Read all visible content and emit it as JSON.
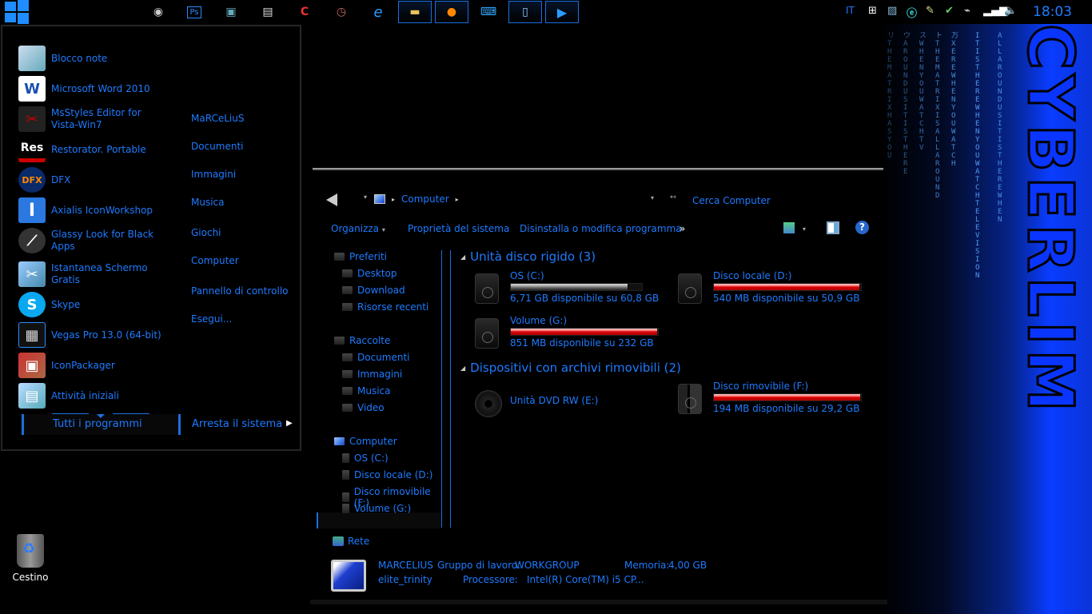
{
  "taskbar": {
    "start_label": "Start",
    "pinned": [
      {
        "name": "webcam",
        "glyph": "◉"
      },
      {
        "name": "photoshop",
        "glyph": "Ps"
      },
      {
        "name": "remote-desktop",
        "glyph": "▣"
      },
      {
        "name": "document-viewer",
        "glyph": "▤"
      },
      {
        "name": "ccleaner",
        "glyph": "C"
      },
      {
        "name": "clock-tool",
        "glyph": "◷"
      },
      {
        "name": "internet-explorer",
        "glyph": "e"
      },
      {
        "name": "file-explorer",
        "glyph": "▬",
        "active": true
      },
      {
        "name": "firefox",
        "glyph": "●",
        "active": true
      },
      {
        "name": "keyboard",
        "glyph": "⌨"
      },
      {
        "name": "notepad",
        "glyph": "▯",
        "active": true
      },
      {
        "name": "media-player",
        "glyph": "▶",
        "active": true
      }
    ],
    "tray": {
      "language": "IT",
      "icons": [
        "windows-flag",
        "snipping-tool",
        "eset",
        "syringe",
        "usb-safe-remove",
        "power",
        "signal",
        "volume"
      ],
      "clock": "18:03"
    }
  },
  "start_menu": {
    "programs": [
      {
        "label": "Blocco note",
        "icon": "notepad"
      },
      {
        "label": "Microsoft Word 2010",
        "icon": "word"
      },
      {
        "label": "MsStyles Editor for Vista-Win7",
        "icon": "msstyles"
      },
      {
        "label": "Restorator. Portable",
        "icon": "restorator"
      },
      {
        "label": "DFX",
        "icon": "dfx"
      },
      {
        "label": "Axialis IconWorkshop",
        "icon": "axialis"
      },
      {
        "label": "Glassy Look for Black Apps",
        "icon": "glassy"
      },
      {
        "label": "Istantanea Schermo Gratis",
        "icon": "screenshot"
      },
      {
        "label": "Skype",
        "icon": "skype"
      },
      {
        "label": "Vegas Pro 13.0 (64-bit)",
        "icon": "vegas"
      },
      {
        "label": "IconPackager",
        "icon": "iconpackager"
      },
      {
        "label": "Attività iniziali",
        "icon": "getting-started"
      }
    ],
    "places": [
      "MaRCeLiuS",
      "Documenti",
      "Immagini",
      "Musica",
      "Giochi",
      "Computer",
      "Pannello di controllo",
      "Esegui..."
    ],
    "all_programs": "Tutti i programmi",
    "shutdown": "Arresta il sistema"
  },
  "desktop": {
    "recycle_bin": "Cestino"
  },
  "wallpaper": {
    "brand": "CYBERLIM"
  },
  "explorer": {
    "breadcrumb": "Computer",
    "search_placeholder": "Cerca Computer",
    "commands": {
      "organize": "Organizza",
      "system_properties": "Proprietà del sistema",
      "uninstall": "Disinstalla o modifica programma",
      "more": "»"
    },
    "nav": {
      "favorites": "Preferiti",
      "favorites_items": [
        "Desktop",
        "Download",
        "Risorse recenti"
      ],
      "libraries": "Raccolte",
      "libraries_items": [
        "Documenti",
        "Immagini",
        "Musica",
        "Video"
      ],
      "computer": "Computer",
      "computer_items": [
        "OS (C:)",
        "Disco locale (D:)",
        "Disco rimovibile (F:)",
        "Volume (G:)"
      ],
      "network": "Rete"
    },
    "groups": {
      "hard_disks": "Unità disco rigido (3)",
      "removable": "Dispositivi con archivi rimovibili (2)"
    },
    "drives": {
      "c": {
        "name": "OS (C:)",
        "free": "6,71 GB disponibile su 60,8 GB",
        "used_pct": 89,
        "color": "gray"
      },
      "d": {
        "name": "Disco locale (D:)",
        "free": "540 MB disponibile su 50,9 GB",
        "used_pct": 99,
        "color": "red"
      },
      "g": {
        "name": "Volume (G:)",
        "free": "851 MB disponibile su 232 GB",
        "used_pct": 99.6,
        "color": "red"
      },
      "e": {
        "name": "Unità DVD RW (E:)"
      },
      "f": {
        "name": "Disco rimovibile (F:)",
        "free": "194 MB disponibile su 29,2 GB",
        "used_pct": 99.4,
        "color": "red"
      }
    },
    "details": {
      "computer_name": "MARCELIUS",
      "user": "elite_trinity",
      "workgroup_label": "Gruppo di lavoro:",
      "workgroup": "WORKGROUP",
      "memory_label": "Memoria:",
      "memory": "4,00 GB",
      "processor_label": "Processore:",
      "processor": "Intel(R) Core(TM) i5 CP..."
    }
  }
}
